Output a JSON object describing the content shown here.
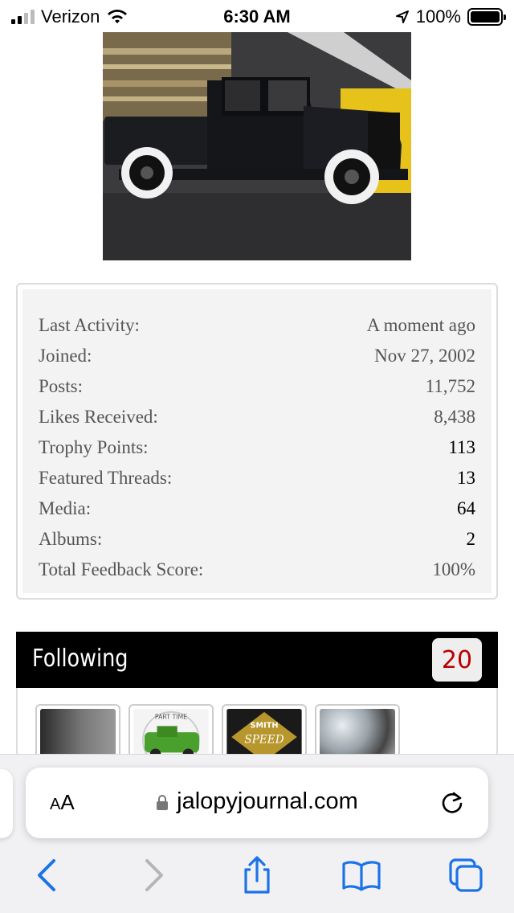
{
  "status_bar": {
    "carrier": "Verizon",
    "time": "6:30 AM",
    "battery": "100%",
    "icons": [
      "signal-icon",
      "wifi-icon",
      "location-arrow-icon",
      "battery-icon"
    ]
  },
  "stats": [
    {
      "label": "Last Activity:",
      "value": "A moment ago"
    },
    {
      "label": "Joined:",
      "value": "Nov 27, 2002"
    },
    {
      "label": "Posts:",
      "value": "11,752"
    },
    {
      "label": "Likes Received:",
      "value": "8,438"
    },
    {
      "label": "Trophy Points:",
      "value": "113"
    },
    {
      "label": "Featured Threads:",
      "value": "13"
    },
    {
      "label": "Media:",
      "value": "64"
    },
    {
      "label": "Albums:",
      "value": "2"
    },
    {
      "label": "Total Feedback Score:",
      "value": "100%"
    }
  ],
  "following": {
    "title": "Following",
    "count": "20",
    "thumbnail_texts": [
      "SMITH",
      "SPEED",
      "PART TIME"
    ]
  },
  "browser": {
    "text_size_label_small": "A",
    "text_size_label_large": "A",
    "url": "jalopyjournal.com",
    "icons": [
      "lock-icon",
      "reload-icon",
      "back-icon",
      "forward-icon",
      "share-icon",
      "bookmarks-icon",
      "tabs-icon"
    ]
  },
  "colors": {
    "following_bar": "#000000",
    "following_count": "#bb0000",
    "safari_accent": "#1a73e8"
  }
}
